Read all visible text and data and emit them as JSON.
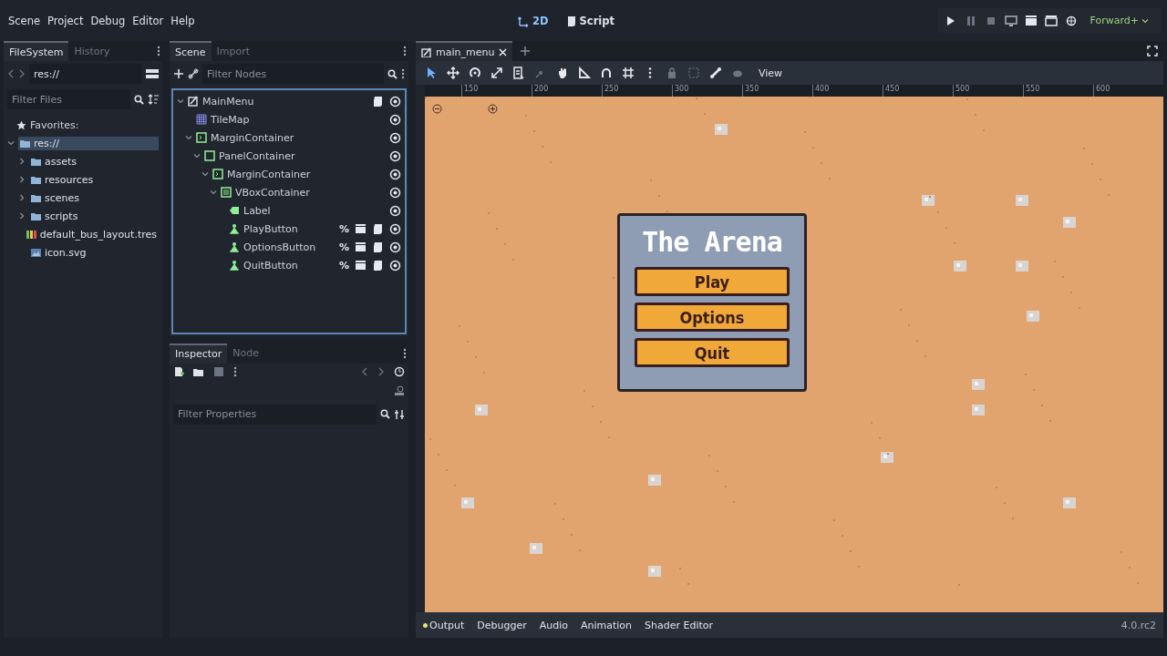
{
  "menu_bar": {
    "menus": [
      "Scene",
      "Project",
      "Debug",
      "Editor",
      "Help"
    ],
    "workspaces": [
      {
        "label": "2D",
        "kind": "canvas",
        "selected": true
      },
      {
        "label": "Script",
        "kind": "script",
        "selected": false
      }
    ],
    "renderer": "Forward+"
  },
  "filesystem": {
    "tabs": [
      {
        "label": "FileSystem",
        "selected": true
      },
      {
        "label": "History",
        "selected": false
      }
    ],
    "path": "res://",
    "filter": {
      "placeholder": "Filter Files"
    },
    "favorites": "Favorites:",
    "tree": [
      {
        "name": "res://",
        "kind": "folder",
        "selected": true,
        "expanded": true,
        "children": [
          {
            "name": "assets",
            "kind": "folder",
            "selected": false,
            "expanded": false
          },
          {
            "name": "resources",
            "kind": "folder",
            "selected": false,
            "expanded": false
          },
          {
            "name": "scenes",
            "kind": "folder",
            "selected": false,
            "expanded": false
          },
          {
            "name": "scripts",
            "kind": "folder",
            "selected": false,
            "expanded": false
          },
          {
            "name": "default_bus_layout.tres",
            "kind": "bus",
            "selected": false
          },
          {
            "name": "icon.svg",
            "kind": "image",
            "selected": false
          }
        ]
      }
    ]
  },
  "scene": {
    "tabs": [
      {
        "label": "Scene",
        "selected": true
      },
      {
        "label": "Import",
        "selected": false
      }
    ],
    "filter": {
      "placeholder": "Filter Nodes"
    },
    "tree": [
      {
        "name": "MainMenu",
        "kind": "root",
        "expanded": true,
        "badges": [
          {
            "kind": "script"
          },
          {
            "kind": "visible"
          }
        ],
        "children": [
          {
            "name": "TileMap",
            "kind": "tilemap",
            "badges": [
              {
                "kind": "visible"
              }
            ]
          },
          {
            "name": "MarginContainer",
            "kind": "margin",
            "expanded": true,
            "badges": [
              {
                "kind": "visible"
              }
            ],
            "children": [
              {
                "name": "PanelContainer",
                "kind": "panel",
                "expanded": true,
                "badges": [
                  {
                    "kind": "visible"
                  }
                ],
                "children": [
                  {
                    "name": "MarginContainer",
                    "kind": "margin",
                    "expanded": true,
                    "badges": [
                      {
                        "kind": "visible"
                      }
                    ],
                    "children": [
                      {
                        "name": "VBoxContainer",
                        "kind": "vbox",
                        "expanded": true,
                        "badges": [
                          {
                            "kind": "visible"
                          }
                        ],
                        "children": [
                          {
                            "name": "Label",
                            "kind": "label",
                            "badges": [
                              {
                                "kind": "visible"
                              }
                            ]
                          },
                          {
                            "name": "PlayButton",
                            "kind": "button",
                            "badges": [
                              {
                                "kind": "unique",
                                "symbol": "%"
                              },
                              {
                                "kind": "group"
                              },
                              {
                                "kind": "script"
                              },
                              {
                                "kind": "visible"
                              }
                            ]
                          },
                          {
                            "name": "OptionsButton",
                            "kind": "button",
                            "badges": [
                              {
                                "kind": "unique",
                                "symbol": "%"
                              },
                              {
                                "kind": "group"
                              },
                              {
                                "kind": "script"
                              },
                              {
                                "kind": "visible"
                              }
                            ]
                          },
                          {
                            "name": "QuitButton",
                            "kind": "button",
                            "badges": [
                              {
                                "kind": "unique",
                                "symbol": "%"
                              },
                              {
                                "kind": "group"
                              },
                              {
                                "kind": "script"
                              },
                              {
                                "kind": "visible"
                              }
                            ]
                          }
                        ]
                      }
                    ]
                  }
                ]
              }
            ]
          }
        ]
      }
    ]
  },
  "inspector": {
    "tabs": [
      {
        "label": "Inspector",
        "selected": true
      },
      {
        "label": "Node",
        "selected": false
      }
    ],
    "filter": {
      "placeholder": "Filter Properties"
    }
  },
  "editor": {
    "tabs": [
      {
        "label": "main_menu",
        "selected": true
      }
    ],
    "view_menu": "View",
    "ruler": [
      "150",
      "200",
      "250",
      "300",
      "350",
      "400",
      "450",
      "500",
      "550",
      "600"
    ],
    "game": {
      "title": "The Arena",
      "buttons": [
        "Play",
        "Options",
        "Quit"
      ]
    }
  },
  "bottom_panel": {
    "tabs": [
      {
        "label": "Output",
        "selected": false,
        "color": "#e8e070"
      },
      {
        "label": "Debugger",
        "selected": false
      },
      {
        "label": "Audio",
        "selected": false
      },
      {
        "label": "Animation",
        "selected": false
      },
      {
        "label": "Shader Editor",
        "selected": false
      }
    ],
    "version": "4.0.rc2"
  }
}
